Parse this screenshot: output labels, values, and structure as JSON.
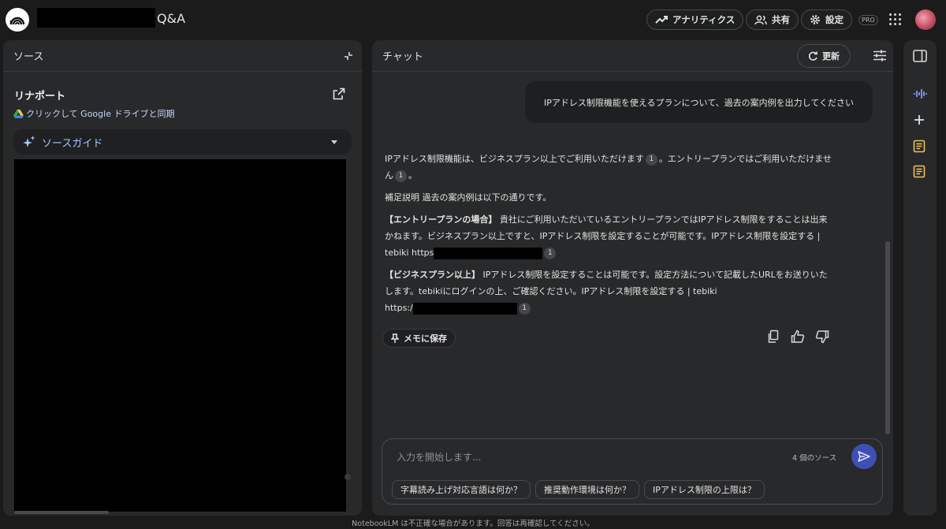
{
  "header": {
    "notebook_title_suffix": "Q&A",
    "analytics_label": "アナリティクス",
    "share_label": "共有",
    "settings_label": "設定",
    "pro_badge": "PRO"
  },
  "sources": {
    "header": "ソース",
    "source_title": "リナポート",
    "drive_sync_label": "クリックして Google ドライブと同期",
    "guide_label": "ソースガイド"
  },
  "chat": {
    "header": "チャット",
    "refresh_label": "更新",
    "user_message": "IPアドレス制限機能を使えるプランについて、過去の案内例を出力してください",
    "answer": {
      "p1a": "IPアドレス制限機能は、ビジネスプラン以上でご利用いただけます",
      "p1b": "。エントリープランではご利用いただけません",
      "p1c": "。",
      "p2": "補足説明 過去の案内例は以下の通りです。",
      "p3_head": "【エントリープランの場合】",
      "p3_body": " 貴社にご利用いただいているエントリープランではIPアドレス制限をすることは出来かねます。ビジネスプラン以上ですと、IPアドレス制限を設定することが可能です。IPアドレス制限を設定する | tebiki https",
      "p4_head": "【ビジネスプラン以上】",
      "p4_body": " IPアドレス制限を設定することは可能です。設定方法について記載したURLをお送りいたします。tebikiにログインの上、ご確認ください。IPアドレス制限を設定する | tebiki",
      "p4_url": "https:/",
      "citation": "1"
    },
    "save_memo_label": "メモに保存",
    "input_placeholder": "入力を開始します...",
    "source_count": "4 個のソース",
    "suggestions": [
      "字幕読み上げ対応言語は何か？",
      "推奨動作環境は何か？",
      "IPアドレス制限の上限は？"
    ]
  },
  "footer": {
    "disclaimer": "NotebookLM は不正確な場合があります。回答は再確認してください。"
  },
  "colors": {
    "background": "#1b1b1c",
    "panel": "#28292a",
    "accent_blue": "#a8c7fa",
    "send_button": "#3e4fb4",
    "note_icon": "#f4c15d"
  }
}
